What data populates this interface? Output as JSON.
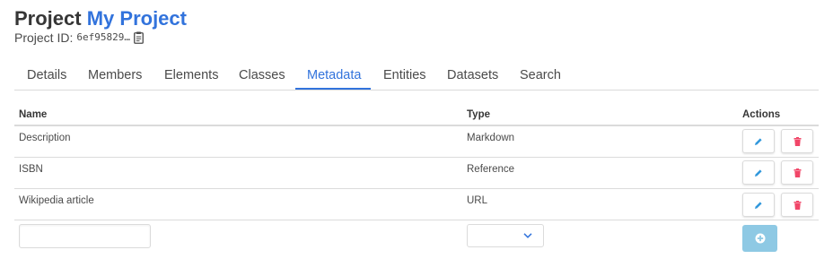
{
  "header": {
    "title_prefix": "Project",
    "project_name": "My Project",
    "id_label": "Project ID:",
    "id_value": "6ef95829…"
  },
  "tabs": [
    {
      "label": "Details"
    },
    {
      "label": "Members"
    },
    {
      "label": "Elements"
    },
    {
      "label": "Classes"
    },
    {
      "label": "Metadata"
    },
    {
      "label": "Entities"
    },
    {
      "label": "Datasets"
    },
    {
      "label": "Search"
    }
  ],
  "active_tab": "Metadata",
  "table": {
    "columns": {
      "name": "Name",
      "type": "Type",
      "actions": "Actions"
    },
    "rows": [
      {
        "name": "Description",
        "type": "Markdown"
      },
      {
        "name": "ISBN",
        "type": "Reference"
      },
      {
        "name": "Wikipedia article",
        "type": "URL"
      }
    ]
  },
  "new_row": {
    "name_value": "",
    "type_value": ""
  },
  "colors": {
    "accent": "#3273dc",
    "edit_icon": "#3298dc",
    "delete_icon": "#f14668",
    "add_button": "#8ec9e4"
  },
  "icons": {
    "copy": "clipboard-icon",
    "edit": "pencil-icon",
    "delete": "trash-icon",
    "add": "plus-circle-icon",
    "select": "chevron-down-icon"
  }
}
